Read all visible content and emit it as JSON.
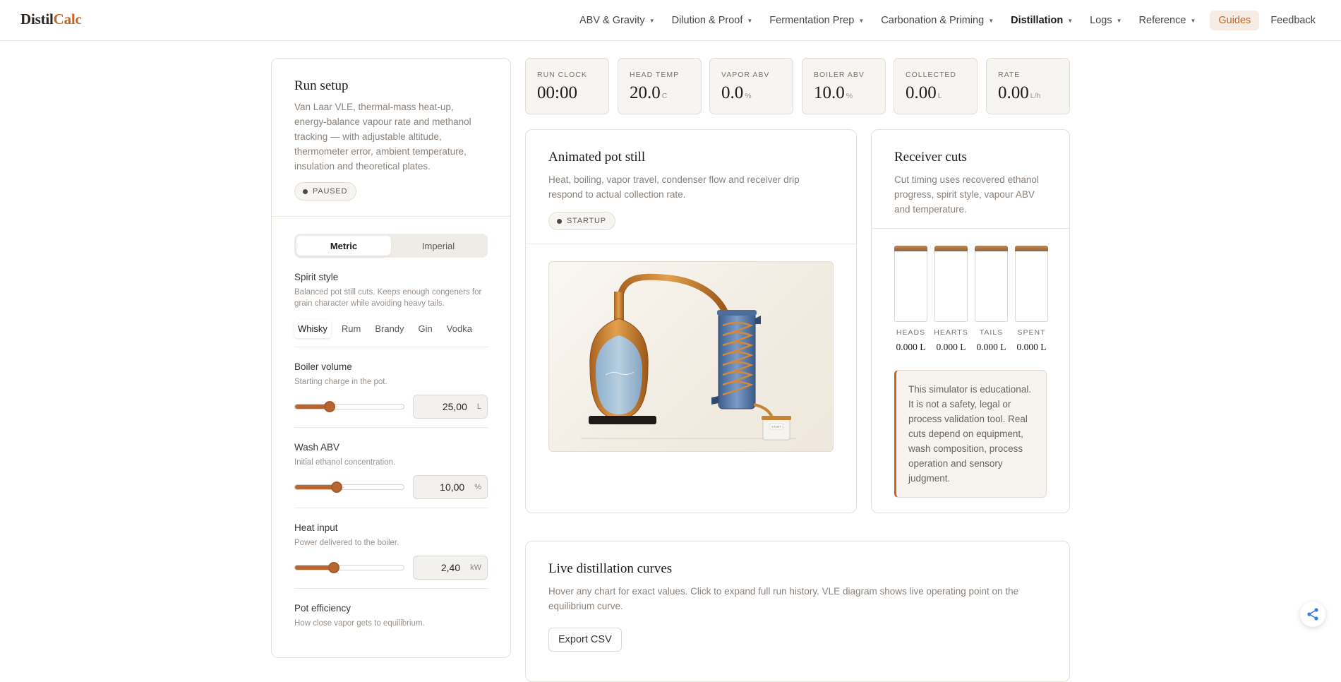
{
  "brand": {
    "part1": "Distil",
    "part2": "Calc"
  },
  "nav": {
    "items": [
      {
        "label": "ABV & Gravity",
        "active": false
      },
      {
        "label": "Dilution & Proof",
        "active": false
      },
      {
        "label": "Fermentation Prep",
        "active": false
      },
      {
        "label": "Carbonation & Priming",
        "active": false
      },
      {
        "label": "Distillation",
        "active": true
      },
      {
        "label": "Logs",
        "active": false
      },
      {
        "label": "Reference",
        "active": false
      }
    ],
    "guides": "Guides",
    "feedback": "Feedback",
    "caret": "▼"
  },
  "setup": {
    "title": "Run setup",
    "desc": "Van Laar VLE, thermal-mass heat-up, energy-balance vapour rate and methanol tracking — with adjustable altitude, thermometer error, ambient temperature, insulation and theoretical plates.",
    "status": "PAUSED",
    "units": {
      "metric": "Metric",
      "imperial": "Imperial",
      "selected": "Metric"
    },
    "spirit_style": {
      "label": "Spirit style",
      "desc": "Balanced pot still cuts. Keeps enough congeners for grain character while avoiding heavy tails.",
      "options": [
        "Whisky",
        "Rum",
        "Brandy",
        "Gin",
        "Vodka"
      ],
      "selected": "Whisky"
    },
    "boiler_volume": {
      "label": "Boiler volume",
      "desc": "Starting charge in the pot.",
      "value": "25,00",
      "unit": "L",
      "level": 0.32
    },
    "wash_abv": {
      "label": "Wash ABV",
      "desc": "Initial ethanol concentration.",
      "value": "10,00",
      "unit": "%",
      "level": 0.38
    },
    "heat_input": {
      "label": "Heat input",
      "desc": "Power delivered to the boiler.",
      "value": "2,40",
      "unit": "kW",
      "level": 0.36
    },
    "pot_efficiency": {
      "label": "Pot efficiency",
      "desc": "How close vapor gets to equilibrium."
    }
  },
  "metrics": [
    {
      "label": "RUN CLOCK",
      "value": "00:00",
      "unit": ""
    },
    {
      "label": "HEAD TEMP",
      "value": "20.0",
      "unit": "C"
    },
    {
      "label": "VAPOR ABV",
      "value": "0.0",
      "unit": "%"
    },
    {
      "label": "BOILER ABV",
      "value": "10.0",
      "unit": "%"
    },
    {
      "label": "COLLECTED",
      "value": "0.00",
      "unit": "L"
    },
    {
      "label": "RATE",
      "value": "0.00",
      "unit": "L/h"
    }
  ],
  "still": {
    "title": "Animated pot still",
    "desc": "Heat, boiling, vapor travel, condenser flow and receiver drip respond to actual collection rate.",
    "status": "STARTUP",
    "receiver_tag": "START"
  },
  "cuts": {
    "title": "Receiver cuts",
    "desc": "Cut timing uses recovered ethanol progress, spirit style, vapour ABV and temperature.",
    "jars": [
      {
        "name": "HEADS",
        "value": "0.000 L"
      },
      {
        "name": "HEARTS",
        "value": "0.000 L"
      },
      {
        "name": "TAILS",
        "value": "0.000 L"
      },
      {
        "name": "SPENT",
        "value": "0.000 L"
      }
    ],
    "note": "This simulator is educational. It is not a safety, legal or process validation tool. Real cuts depend on equipment, wash composition, process operation and sensory judgment."
  },
  "curves": {
    "title": "Live distillation curves",
    "desc": "Hover any chart for exact values. Click to expand full run history. VLE diagram shows live operating point on the equilibrium curve.",
    "export": "Export CSV"
  },
  "colors": {
    "accent": "#c0652c",
    "copper": "#d08a3e",
    "condenser": "#5a7aa8"
  },
  "icons": {
    "share": "share-icon"
  }
}
